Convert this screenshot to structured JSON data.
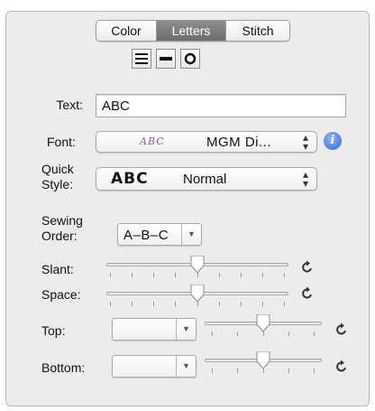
{
  "tabs": [
    {
      "label": "Color",
      "selected": false
    },
    {
      "label": "Letters",
      "selected": true
    },
    {
      "label": "Stitch",
      "selected": false
    }
  ],
  "layout_icons": [
    "lines-layout-icon",
    "bar-layout-icon",
    "circle-layout-icon"
  ],
  "text_field": {
    "label": "Text:",
    "value": "ABC"
  },
  "font": {
    "label": "Font:",
    "preview": "ABC",
    "value": "MGM Di...",
    "preview_color": "#8b5aa0"
  },
  "quick_style": {
    "label_line1": "Quick",
    "label_line2": "Style:",
    "preview": "ABC",
    "value": "Normal"
  },
  "sewing_order": {
    "label_line1": "Sewing",
    "label_line2": "Order:",
    "value": "A–B–C"
  },
  "slant": {
    "label": "Slant:",
    "value": 0.5
  },
  "space": {
    "label": "Space:",
    "value": 0.5
  },
  "top": {
    "label": "Top:",
    "value": 0.5
  },
  "bottom": {
    "label": "Bottom:",
    "value": 0.5
  },
  "colors": {
    "accent": "#5b7fe0",
    "selected_tab": "#7a7a7a"
  }
}
